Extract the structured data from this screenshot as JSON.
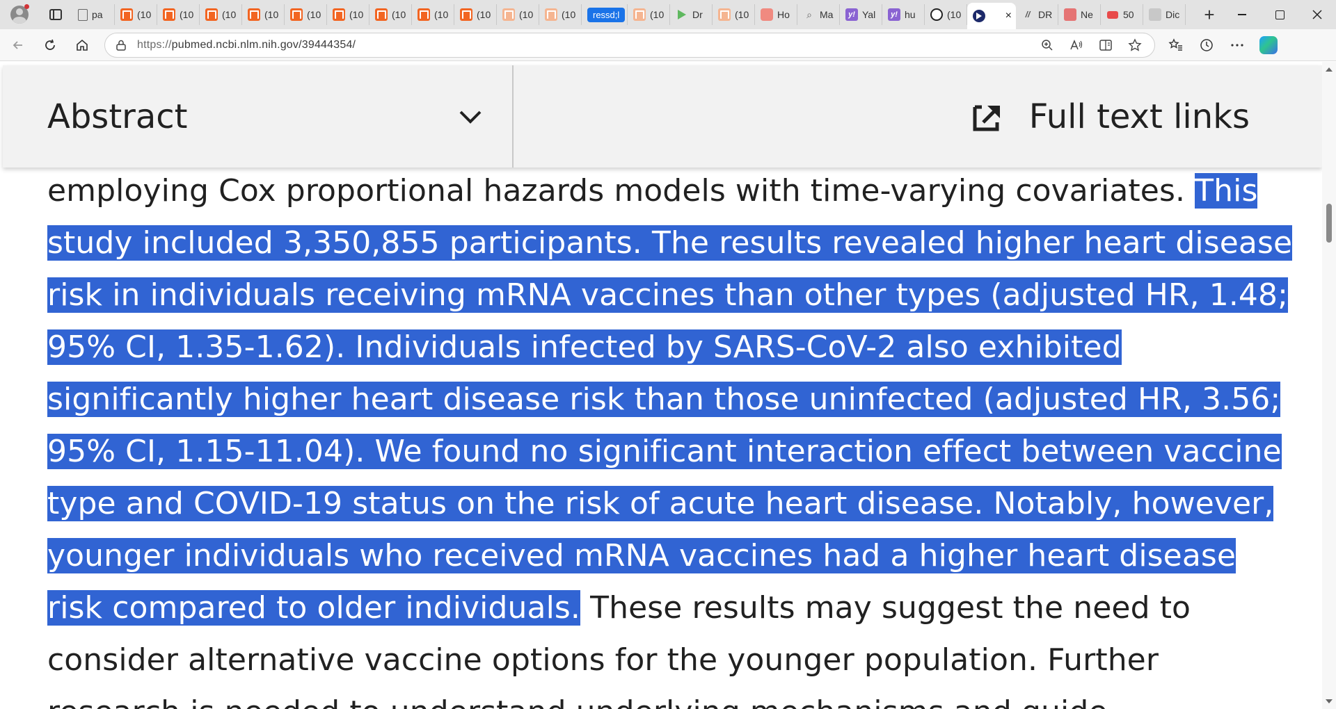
{
  "browser": {
    "tabs": [
      {
        "title": "pa",
        "icon": "document-icon"
      },
      {
        "title": "(10",
        "icon": "substack-icon"
      },
      {
        "title": "(10",
        "icon": "substack-icon"
      },
      {
        "title": "(10",
        "icon": "substack-icon"
      },
      {
        "title": "(10",
        "icon": "substack-icon"
      },
      {
        "title": "(10",
        "icon": "substack-icon"
      },
      {
        "title": "(10",
        "icon": "substack-icon"
      },
      {
        "title": "(10",
        "icon": "substack-icon"
      },
      {
        "title": "(10",
        "icon": "substack-icon"
      },
      {
        "title": "(10",
        "icon": "substack-icon"
      },
      {
        "title": "(10",
        "icon": "substack-icon"
      },
      {
        "title": "(10",
        "icon": "substack-icon"
      },
      {
        "title": "ressd;l",
        "icon": "highlight-pill"
      },
      {
        "title": "(10",
        "icon": "substack-icon"
      },
      {
        "title": "Dr",
        "icon": "play-icon"
      },
      {
        "title": "(10",
        "icon": "substack-icon"
      },
      {
        "title": "Ho",
        "icon": "microphone-icon"
      },
      {
        "title": "Ma",
        "icon": "search-icon"
      },
      {
        "title": "Yal",
        "icon": "yahoo-icon"
      },
      {
        "title": "hu",
        "icon": "yahoo-icon"
      },
      {
        "title": "(10",
        "icon": "face-icon"
      },
      {
        "title": "",
        "icon": "arrow-icon",
        "active": true
      },
      {
        "title": "DR",
        "icon": "slash-icon"
      },
      {
        "title": "Ne",
        "icon": "r-icon"
      },
      {
        "title": "50",
        "icon": "youtube-icon"
      },
      {
        "title": "Dic",
        "icon": "generic-icon"
      }
    ],
    "new_tab_symbol": "+",
    "active_tab_close": "×",
    "address": {
      "scheme": "https://",
      "host": "pubmed.ncbi.nlm.nih.gov",
      "path": "/39444354/"
    }
  },
  "page": {
    "section_title": "Abstract",
    "full_text_links": "Full text links",
    "abstract_lines": [
      {
        "before": "employing Cox proportional hazards models with time-varying covariates. ",
        "selected": "This",
        "after": ""
      },
      {
        "before": "",
        "selected": "study included 3,350,855 participants. The results revealed higher heart disease",
        "after": ""
      },
      {
        "before": "",
        "selected": "risk in individuals receiving mRNA vaccines than other types (adjusted HR, 1.48;",
        "after": ""
      },
      {
        "before": "",
        "selected": "95% CI, 1.35-1.62). Individuals infected by SARS-CoV-2 also exhibited",
        "after": ""
      },
      {
        "before": "",
        "selected": "significantly higher heart disease risk than those uninfected (adjusted HR, 3.56;",
        "after": ""
      },
      {
        "before": "",
        "selected": "95% CI, 1.15-11.04). We found no significant interaction effect between vaccine",
        "after": ""
      },
      {
        "before": "",
        "selected": "type and COVID-19 status on the risk of acute heart disease. Notably, however,",
        "after": ""
      },
      {
        "before": "",
        "selected": "younger individuals who received mRNA vaccines had a higher heart disease",
        "after": ""
      },
      {
        "before": "",
        "selected": "risk compared to older individuals.",
        "after": " These results may suggest the need to"
      },
      {
        "before": "consider alternative vaccine options for the younger population. Further",
        "selected": "",
        "after": ""
      },
      {
        "before": "research is needed to understand underlying mechanisms and guide",
        "selected": "",
        "after": ""
      }
    ]
  },
  "colors": {
    "selection": "#3164d3",
    "sticky_header_bg": "#f2f2f2",
    "tab_strip_bg": "#e3e3e3"
  }
}
